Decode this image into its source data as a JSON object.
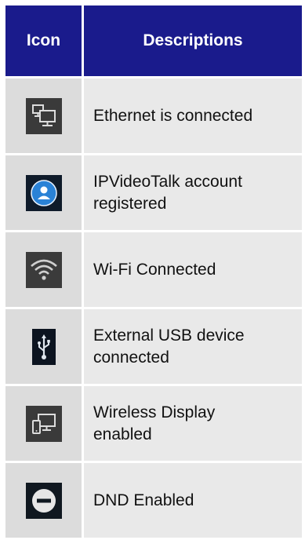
{
  "header": {
    "icon_label": "Icon",
    "desc_label": "Descriptions"
  },
  "rows": [
    {
      "icon": "ethernet-icon",
      "icon_bg": "#3a3a3a",
      "description": "Ethernet is connected"
    },
    {
      "icon": "account-icon",
      "icon_bg": "#0f1b2a",
      "description": "IPVideoTalk account\nregistered"
    },
    {
      "icon": "wifi-icon",
      "icon_bg": "#3b3b3b",
      "description": "Wi-Fi Connected"
    },
    {
      "icon": "usb-icon",
      "icon_bg": "#0c1420",
      "description": "External USB device\nconnected"
    },
    {
      "icon": "wireless-display-icon",
      "icon_bg": "#3a3a3a",
      "description": "Wireless Display\nenabled"
    },
    {
      "icon": "dnd-icon",
      "icon_bg": "#101820",
      "description": "DND Enabled"
    }
  ],
  "colors": {
    "header_bg": "#1a1b8c",
    "icon_cell_bg": "#dcdcdc",
    "desc_cell_bg": "#e9e9e9"
  }
}
